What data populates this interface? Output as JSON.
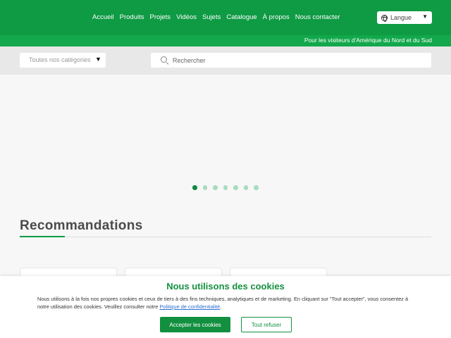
{
  "nav": {
    "items": [
      "Accueil",
      "Produits",
      "Projets",
      "Vidéos",
      "Sujets",
      "Catalogue",
      "À propos",
      "Nous contacter"
    ]
  },
  "language": {
    "label": "Langue",
    "icon": "globe-icon",
    "caret": "▼"
  },
  "region": {
    "text": "Pour les visiteurs d'Amérique du Nord et du Sud"
  },
  "category_select": {
    "value": "Toutes nos catégories",
    "caret": "▼"
  },
  "search": {
    "placeholder": "Rechercher",
    "icon": "search-icon"
  },
  "carousel": {
    "slide_count": 7,
    "active_index": 0
  },
  "recommendations": {
    "title": "Recommandations"
  },
  "cookie_banner": {
    "title": "Nous utilisons des cookies",
    "text": "Nous utilisons à la fois nos propres cookies et ceux de tiers à des fins techniques, analytiques et de marketing. En cliquant sur \"Tout accepter\", vous consentez à notre utilisation des cookies. Veuillez consulter notre ",
    "link_text": "Politique de confidentialité",
    "text_end": ".",
    "accept_label": "Accepter les cookies",
    "refuse_label": "Tout refuser"
  },
  "colors": {
    "brand_green": "#0f9a44",
    "region_green": "#12a84b",
    "dot_inactive": "#a9dbc0",
    "dot_active": "#10883f",
    "link": "#2b6fd1"
  }
}
